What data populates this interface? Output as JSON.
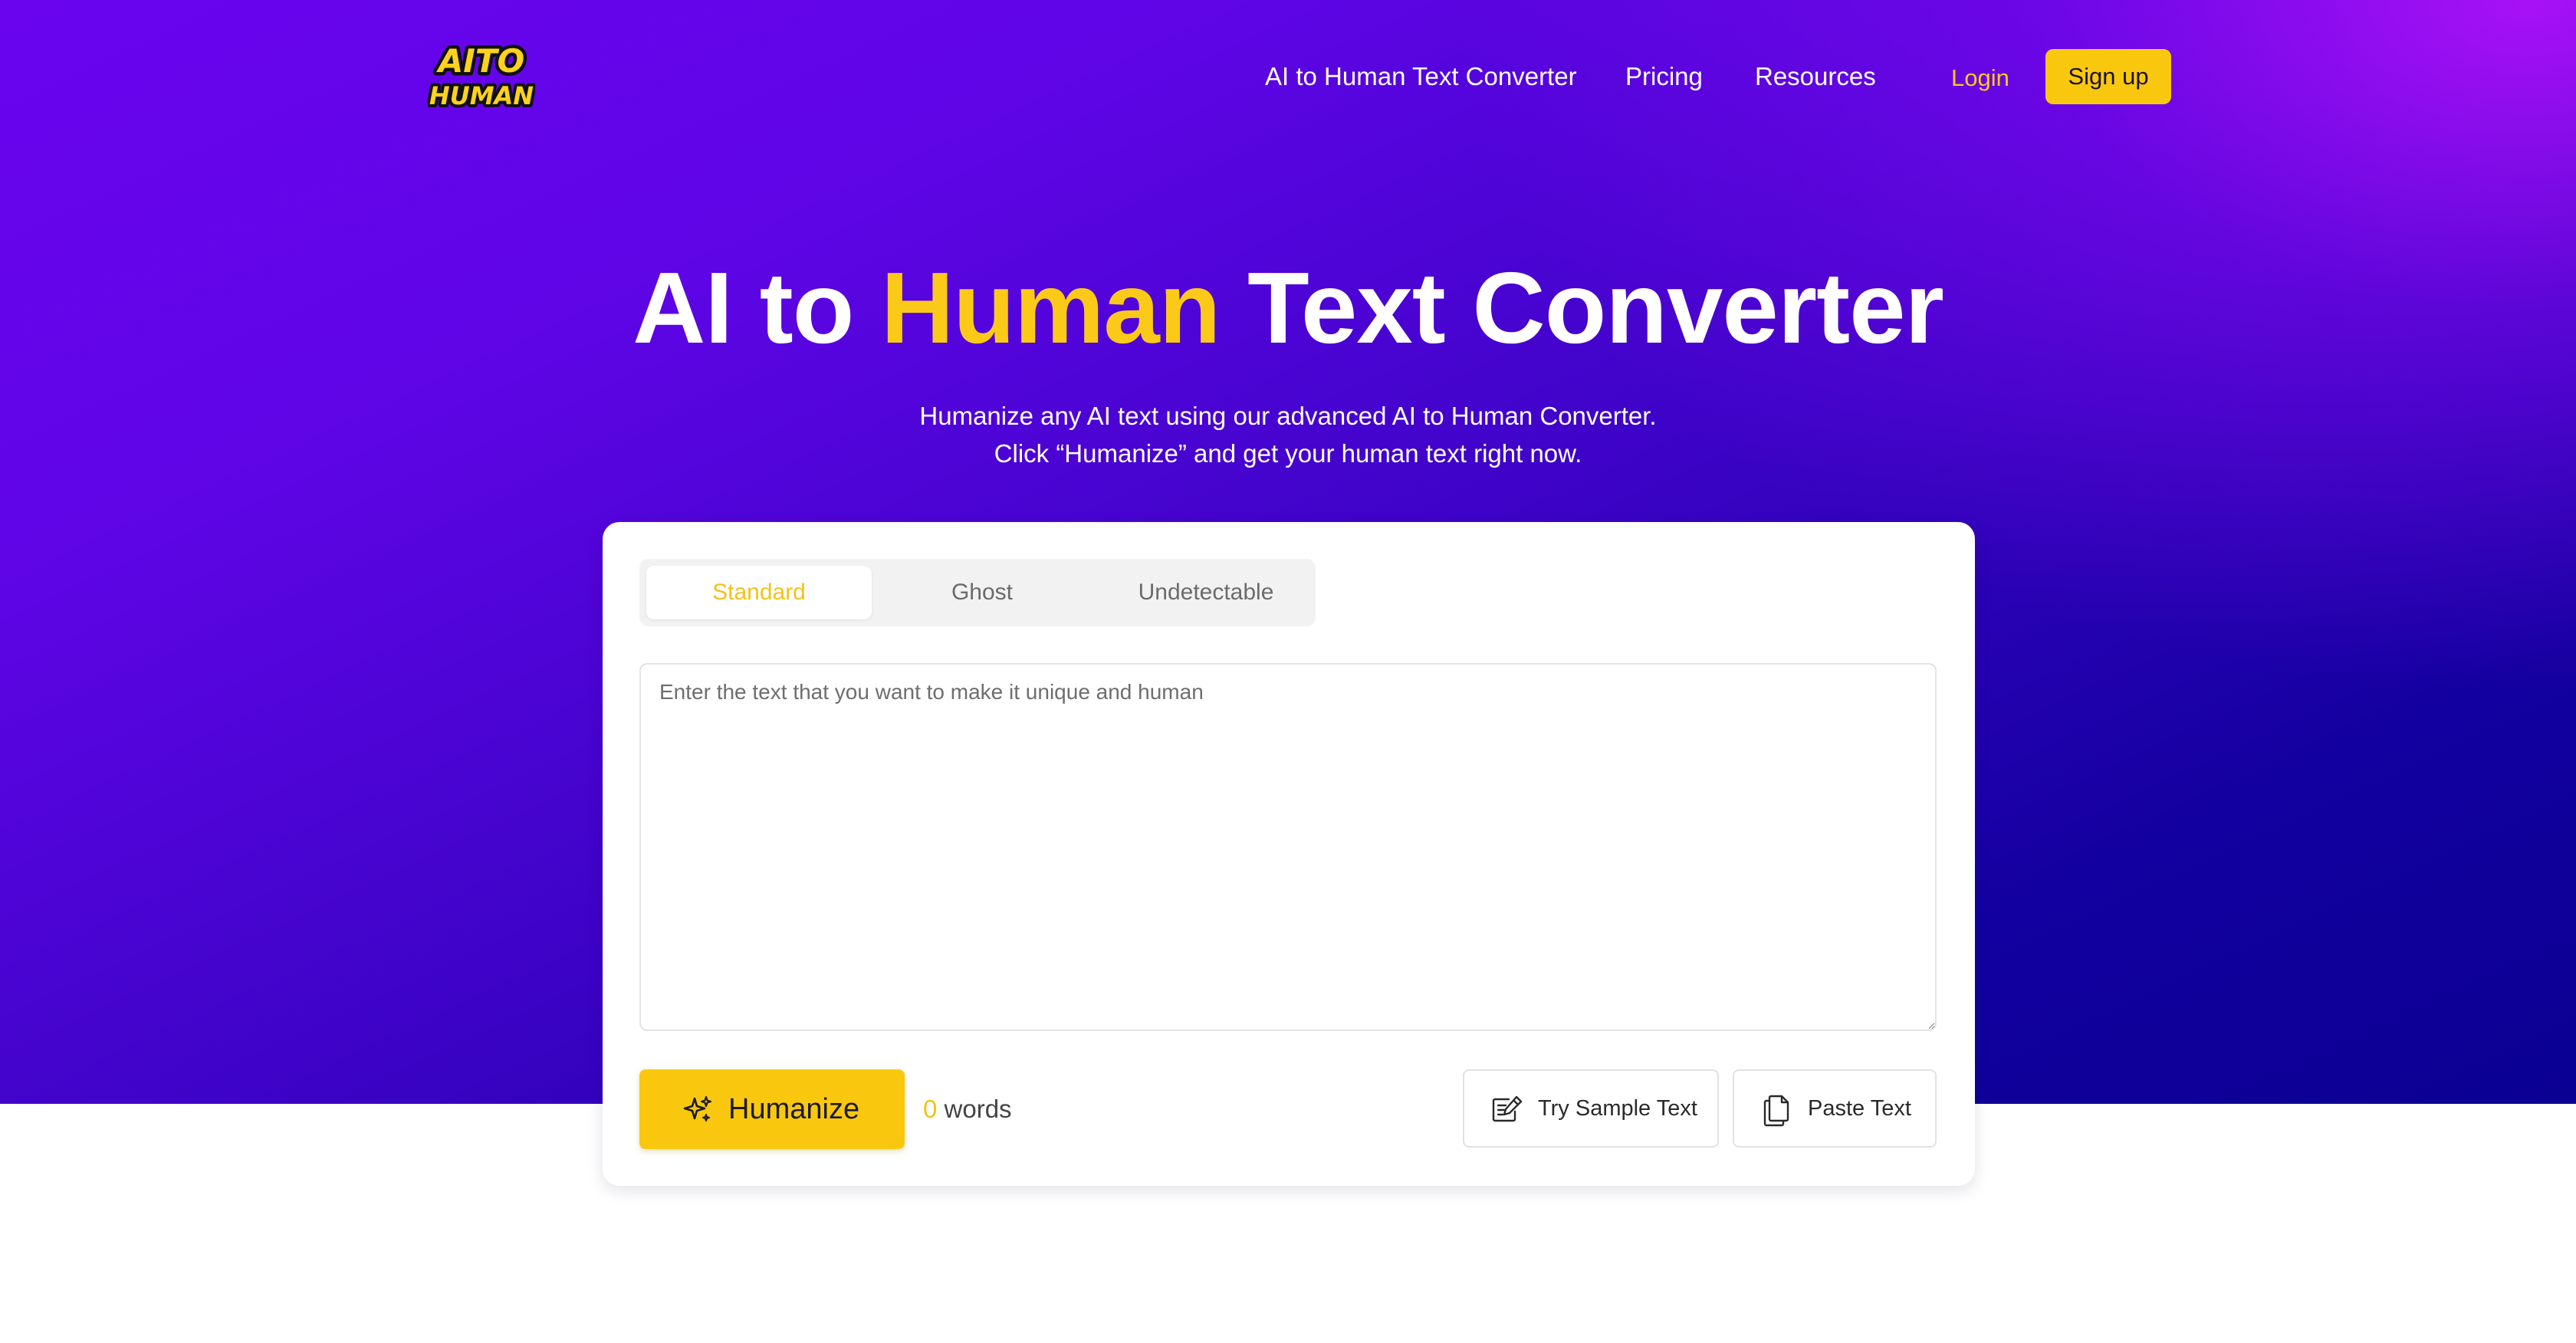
{
  "brand": {
    "logo_line1": "AITO",
    "logo_line2": "HUMAN",
    "logo_yellow": "#FFD21E",
    "logo_outline": "#111111"
  },
  "nav": {
    "links": [
      {
        "label": "AI to Human Text Converter"
      },
      {
        "label": "Pricing"
      },
      {
        "label": "Resources"
      }
    ],
    "login_label": "Login",
    "signup_label": "Sign up"
  },
  "hero": {
    "title_part1": "AI to ",
    "title_accent": "Human",
    "title_part2": " Text Converter",
    "subtitle_line1": "Humanize any AI text using our advanced AI to Human Converter.",
    "subtitle_line2": "Click “Humanize” and get your human text right now."
  },
  "converter": {
    "modes": [
      {
        "label": "Standard",
        "selected": true
      },
      {
        "label": "Ghost",
        "selected": false
      },
      {
        "label": "Undetectable",
        "selected": false
      }
    ],
    "input_placeholder": "Enter the text that you want to make it unique and human",
    "input_value": "",
    "humanize_label": "Humanize",
    "word_count": "0",
    "word_count_suffix": " words",
    "sample_label": "Try Sample Text",
    "paste_label": "Paste Text"
  },
  "colors": {
    "accent_yellow": "#F9C80E",
    "hero_gradient_start": "#6A04EF",
    "hero_gradient_end": "#0A0092",
    "hero_glow": "#BA14FF"
  },
  "icons": {
    "humanize": "sparkles-icon",
    "sample": "edit-note-icon",
    "paste": "copy-documents-icon"
  }
}
